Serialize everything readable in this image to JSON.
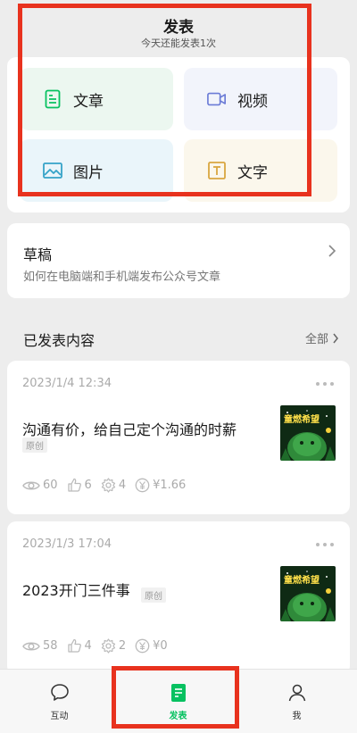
{
  "header": {
    "title": "发表",
    "subtitle": "今天还能发表1次"
  },
  "publish_types": [
    {
      "label": "文章",
      "icon": "article-icon",
      "color": "#07c160"
    },
    {
      "label": "视频",
      "icon": "video-icon",
      "color": "#6b7bd6"
    },
    {
      "label": "图片",
      "icon": "image-icon",
      "color": "#35a3c8"
    },
    {
      "label": "文字",
      "icon": "text-icon",
      "color": "#d9a640"
    }
  ],
  "draft": {
    "title": "草稿",
    "subtitle": "如何在电脑端和手机端发布公众号文章"
  },
  "published": {
    "title": "已发表内容",
    "all_label": "全部",
    "posts": [
      {
        "time": "2023/1/4 12:34",
        "title": "沟通有价，给自己定个沟通的时薪",
        "badge": "原创",
        "views": "60",
        "likes": "6",
        "shares": "4",
        "earnings": "¥1.66"
      },
      {
        "time": "2023/1/3 17:04",
        "title": "2023开门三件事",
        "badge": "原创",
        "views": "58",
        "likes": "4",
        "shares": "2",
        "earnings": "¥0"
      }
    ]
  },
  "thumbnail_text": "童燃希望",
  "nav": [
    {
      "label": "互动",
      "icon": "chat-bubble-icon"
    },
    {
      "label": "发表",
      "icon": "document-icon",
      "active": true,
      "color": "#07c160"
    },
    {
      "label": "我",
      "icon": "person-icon"
    }
  ],
  "colors": {
    "accent": "#07c160",
    "annotation_red": "#e8321e"
  }
}
